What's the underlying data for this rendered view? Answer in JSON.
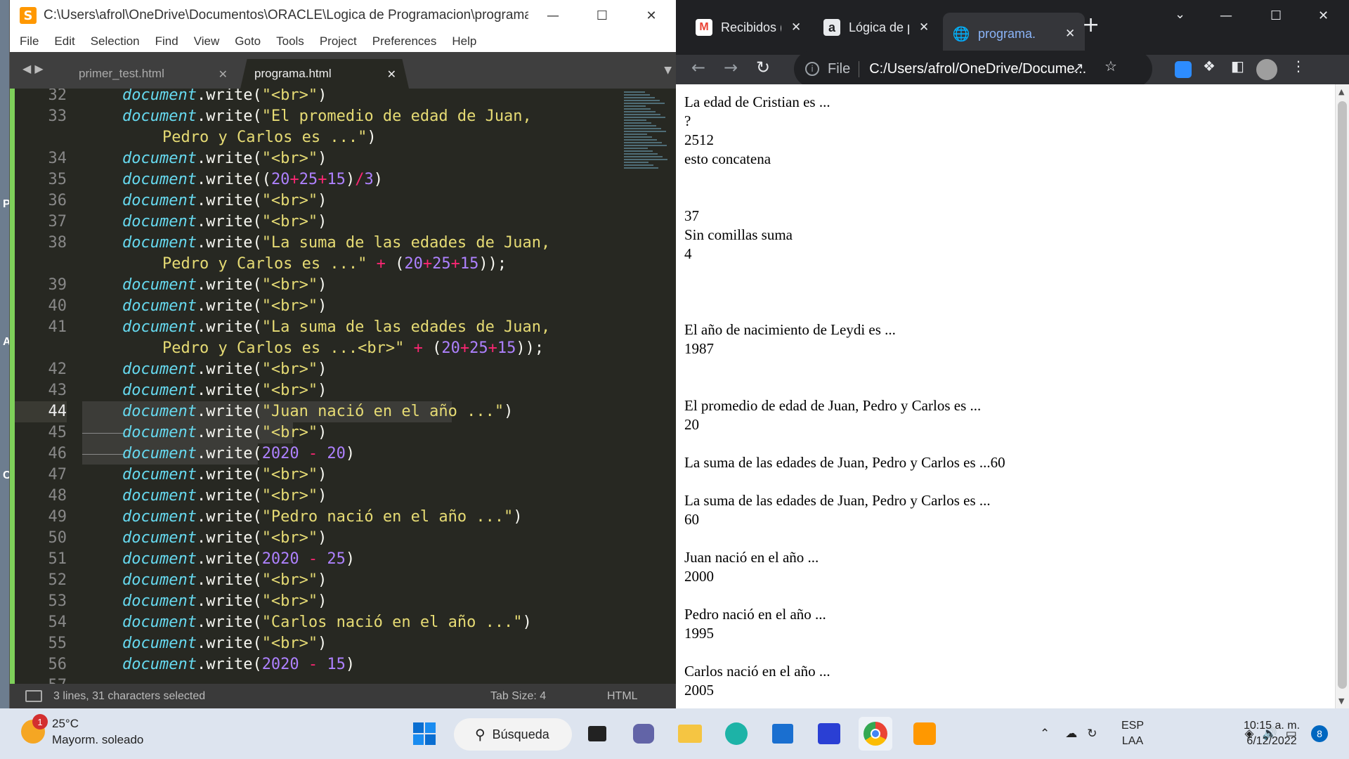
{
  "editor": {
    "title": "C:\\Users\\afrol\\OneDrive\\Documentos\\ORACLE\\Logica de Programacion\\programa.htm...",
    "menu": [
      "File",
      "Edit",
      "Selection",
      "Find",
      "View",
      "Goto",
      "Tools",
      "Project",
      "Preferences",
      "Help"
    ],
    "tabs": [
      "primer_test.html",
      "programa.html"
    ],
    "status": {
      "selection": "3 lines, 31 characters selected",
      "tab_size": "Tab Size: 4",
      "syntax": "HTML"
    },
    "lines": [
      {
        "n": "32",
        "parts": [
          [
            "doc",
            "document"
          ],
          [
            "t",
            ".write("
          ],
          [
            "str",
            "\"<br>\""
          ],
          [
            "t",
            ")"
          ]
        ]
      },
      {
        "n": "33",
        "parts": [
          [
            "doc",
            "document"
          ],
          [
            "t",
            ".write("
          ],
          [
            "str",
            "\"El promedio de edad de Juan,"
          ]
        ]
      },
      {
        "n": "",
        "wrap": true,
        "parts": [
          [
            "str",
            "Pedro y Carlos es ...\""
          ],
          [
            "t",
            ")"
          ]
        ]
      },
      {
        "n": "34",
        "parts": [
          [
            "doc",
            "document"
          ],
          [
            "t",
            ".write("
          ],
          [
            "str",
            "\"<br>\""
          ],
          [
            "t",
            ")"
          ]
        ]
      },
      {
        "n": "35",
        "parts": [
          [
            "doc",
            "document"
          ],
          [
            "t",
            ".write(("
          ],
          [
            "num",
            "20"
          ],
          [
            "op",
            "+"
          ],
          [
            "num",
            "25"
          ],
          [
            "op",
            "+"
          ],
          [
            "num",
            "15"
          ],
          [
            "t",
            ")"
          ],
          [
            "op",
            "/"
          ],
          [
            "num",
            "3"
          ],
          [
            "t",
            ")"
          ]
        ]
      },
      {
        "n": "36",
        "parts": [
          [
            "doc",
            "document"
          ],
          [
            "t",
            ".write("
          ],
          [
            "str",
            "\"<br>\""
          ],
          [
            "t",
            ")"
          ]
        ]
      },
      {
        "n": "37",
        "parts": [
          [
            "doc",
            "document"
          ],
          [
            "t",
            ".write("
          ],
          [
            "str",
            "\"<br>\""
          ],
          [
            "t",
            ")"
          ]
        ]
      },
      {
        "n": "38",
        "parts": [
          [
            "doc",
            "document"
          ],
          [
            "t",
            ".write("
          ],
          [
            "str",
            "\"La suma de las edades de Juan,"
          ]
        ]
      },
      {
        "n": "",
        "wrap": true,
        "parts": [
          [
            "str",
            "Pedro y Carlos es ...\""
          ],
          [
            "t",
            " "
          ],
          [
            "op",
            "+"
          ],
          [
            "t",
            " ("
          ],
          [
            "num",
            "20"
          ],
          [
            "op",
            "+"
          ],
          [
            "num",
            "25"
          ],
          [
            "op",
            "+"
          ],
          [
            "num",
            "15"
          ],
          [
            "t",
            "));"
          ]
        ]
      },
      {
        "n": "39",
        "parts": [
          [
            "doc",
            "document"
          ],
          [
            "t",
            ".write("
          ],
          [
            "str",
            "\"<br>\""
          ],
          [
            "t",
            ")"
          ]
        ]
      },
      {
        "n": "40",
        "parts": [
          [
            "doc",
            "document"
          ],
          [
            "t",
            ".write("
          ],
          [
            "str",
            "\"<br>\""
          ],
          [
            "t",
            ")"
          ]
        ]
      },
      {
        "n": "41",
        "parts": [
          [
            "doc",
            "document"
          ],
          [
            "t",
            ".write("
          ],
          [
            "str",
            "\"La suma de las edades de Juan,"
          ]
        ]
      },
      {
        "n": "",
        "wrap": true,
        "parts": [
          [
            "str",
            "Pedro y Carlos es ...<br>\""
          ],
          [
            "t",
            " "
          ],
          [
            "op",
            "+"
          ],
          [
            "t",
            " ("
          ],
          [
            "num",
            "20"
          ],
          [
            "op",
            "+"
          ],
          [
            "num",
            "25"
          ],
          [
            "op",
            "+"
          ],
          [
            "num",
            "15"
          ],
          [
            "t",
            "));"
          ]
        ]
      },
      {
        "n": "42",
        "parts": [
          [
            "doc",
            "document"
          ],
          [
            "t",
            ".write("
          ],
          [
            "str",
            "\"<br>\""
          ],
          [
            "t",
            ")"
          ]
        ]
      },
      {
        "n": "43",
        "parts": [
          [
            "doc",
            "document"
          ],
          [
            "t",
            ".write("
          ],
          [
            "str",
            "\"<br>\""
          ],
          [
            "t",
            ")"
          ]
        ]
      },
      {
        "n": "44",
        "cur": true,
        "parts": [
          [
            "doc",
            "document"
          ],
          [
            "t",
            ".write("
          ],
          [
            "str",
            "\"Juan nació en el año ...\""
          ],
          [
            "t",
            ")"
          ]
        ]
      },
      {
        "n": "45",
        "guide": true,
        "parts": [
          [
            "doc",
            "document"
          ],
          [
            "t",
            ".write("
          ],
          [
            "str",
            "\"<br>\""
          ],
          [
            "t",
            ")"
          ]
        ]
      },
      {
        "n": "46",
        "guide": true,
        "parts": [
          [
            "doc",
            "document"
          ],
          [
            "t",
            ".write("
          ],
          [
            "num",
            "2020"
          ],
          [
            "t",
            " "
          ],
          [
            "op",
            "-"
          ],
          [
            "t",
            " "
          ],
          [
            "num",
            "20"
          ],
          [
            "t",
            ")"
          ]
        ]
      },
      {
        "n": "47",
        "parts": [
          [
            "doc",
            "document"
          ],
          [
            "t",
            ".write("
          ],
          [
            "str",
            "\"<br>\""
          ],
          [
            "t",
            ")"
          ]
        ]
      },
      {
        "n": "48",
        "parts": [
          [
            "doc",
            "document"
          ],
          [
            "t",
            ".write("
          ],
          [
            "str",
            "\"<br>\""
          ],
          [
            "t",
            ")"
          ]
        ]
      },
      {
        "n": "49",
        "parts": [
          [
            "doc",
            "document"
          ],
          [
            "t",
            ".write("
          ],
          [
            "str",
            "\"Pedro nació en el año ...\""
          ],
          [
            "t",
            ")"
          ]
        ]
      },
      {
        "n": "50",
        "parts": [
          [
            "doc",
            "document"
          ],
          [
            "t",
            ".write("
          ],
          [
            "str",
            "\"<br>\""
          ],
          [
            "t",
            ")"
          ]
        ]
      },
      {
        "n": "51",
        "parts": [
          [
            "doc",
            "document"
          ],
          [
            "t",
            ".write("
          ],
          [
            "num",
            "2020"
          ],
          [
            "t",
            " "
          ],
          [
            "op",
            "-"
          ],
          [
            "t",
            " "
          ],
          [
            "num",
            "25"
          ],
          [
            "t",
            ")"
          ]
        ]
      },
      {
        "n": "52",
        "parts": [
          [
            "doc",
            "document"
          ],
          [
            "t",
            ".write("
          ],
          [
            "str",
            "\"<br>\""
          ],
          [
            "t",
            ")"
          ]
        ]
      },
      {
        "n": "53",
        "parts": [
          [
            "doc",
            "document"
          ],
          [
            "t",
            ".write("
          ],
          [
            "str",
            "\"<br>\""
          ],
          [
            "t",
            ")"
          ]
        ]
      },
      {
        "n": "54",
        "parts": [
          [
            "doc",
            "document"
          ],
          [
            "t",
            ".write("
          ],
          [
            "str",
            "\"Carlos nació en el año ...\""
          ],
          [
            "t",
            ")"
          ]
        ]
      },
      {
        "n": "55",
        "parts": [
          [
            "doc",
            "document"
          ],
          [
            "t",
            ".write("
          ],
          [
            "str",
            "\"<br>\""
          ],
          [
            "t",
            ")"
          ]
        ]
      },
      {
        "n": "56",
        "parts": [
          [
            "doc",
            "document"
          ],
          [
            "t",
            ".write("
          ],
          [
            "num",
            "2020"
          ],
          [
            "t",
            " "
          ],
          [
            "op",
            "-"
          ],
          [
            "t",
            " "
          ],
          [
            "num",
            "15"
          ],
          [
            "t",
            ")"
          ]
        ]
      },
      {
        "n": "57",
        "parts": []
      }
    ]
  },
  "browser": {
    "tabs": [
      {
        "icon": "M",
        "title": "Recibidos ("
      },
      {
        "icon": "a",
        "title": "Lógica de p"
      },
      {
        "icon": "globe",
        "title": "programa."
      }
    ],
    "omnibox": {
      "scheme": "File",
      "url": "C:/Users/afrol/OneDrive/Docume..."
    },
    "page_lines": [
      "La edad de Cristian es ...",
      "?",
      "2512",
      "esto concatena",
      "",
      "",
      "37",
      "Sin comillas suma",
      "4",
      "",
      "",
      "",
      "El año de nacimiento de Leydi es ...",
      "1987",
      "",
      "",
      "El promedio de edad de Juan, Pedro y Carlos es ...",
      "20",
      "",
      "La suma de las edades de Juan, Pedro y Carlos es ...60",
      "",
      "La suma de las edades de Juan, Pedro y Carlos es ...",
      "60",
      "",
      "Juan nació en el año ...",
      "2000",
      "",
      "Pedro nació en el año ...",
      "1995",
      "",
      "Carlos nació en el año ...",
      "2005"
    ]
  },
  "taskbar": {
    "weather": {
      "temp": "25°C",
      "desc": "Mayorm. soleado",
      "badge": "1"
    },
    "search_label": "Búsqueda",
    "lang": {
      "top": "ESP",
      "bottom": "LAA"
    },
    "clock": {
      "time": "10:15 a. m.",
      "date": "6/12/2022"
    },
    "notifications": "8"
  },
  "colors": {
    "string": "#e6db74",
    "keyword_doc": "#66d9ef",
    "number": "#ae81ff",
    "operator": "#f92672",
    "editor_bg": "#272822"
  }
}
